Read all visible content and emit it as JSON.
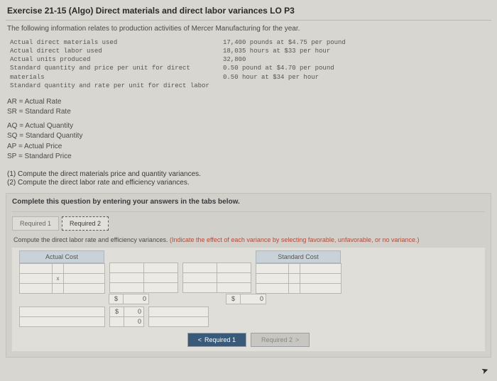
{
  "title": "Exercise 21-15 (Algo) Direct materials and direct labor variances LO P3",
  "intro": "The following information relates to production activities of Mercer Manufacturing for the year.",
  "data_labels": {
    "l1": "Actual direct materials used",
    "l2": "Actual direct labor used",
    "l3": "Actual units produced",
    "l4": "Standard quantity and price per unit for direct materials",
    "l5": "Standard quantity and rate per unit for direct labor"
  },
  "data_values": {
    "v1": "17,400 pounds at $4.75 per pound",
    "v2": "18,035 hours at $33 per hour",
    "v3": "32,800",
    "v4": "0.50 pound at $4.70 per pound",
    "v5": "0.50 hour at $34 per hour"
  },
  "defs": {
    "ar": "AR = Actual Rate",
    "sr": "SR = Standard Rate",
    "aq": "AQ = Actual Quantity",
    "sq": "SQ = Standard Quantity",
    "ap": "AP = Actual Price",
    "sp": "SP = Standard Price"
  },
  "reqs": {
    "r1": "(1) Compute the direct materials price and quantity variances.",
    "r2": "(2) Compute the direct labor rate and efficiency variances."
  },
  "panel_head": "Complete this question by entering your answers in the tabs below.",
  "tabs": {
    "t1": "Required 1",
    "t2": "Required 2"
  },
  "instruct_main": "Compute the direct labor rate and efficiency variances. ",
  "instruct_hint": "(Indicate the effect of each variance by selecting favorable, unfavorable, or no variance.)",
  "headers": {
    "left": "Actual Cost",
    "right": "Standard Cost"
  },
  "symbols": {
    "x": "x",
    "dollar": "$",
    "zero": "0"
  },
  "nav": {
    "prev_label": "Required 1",
    "next_label": "Required 2",
    "chev_l": "<",
    "chev_r": ">"
  }
}
